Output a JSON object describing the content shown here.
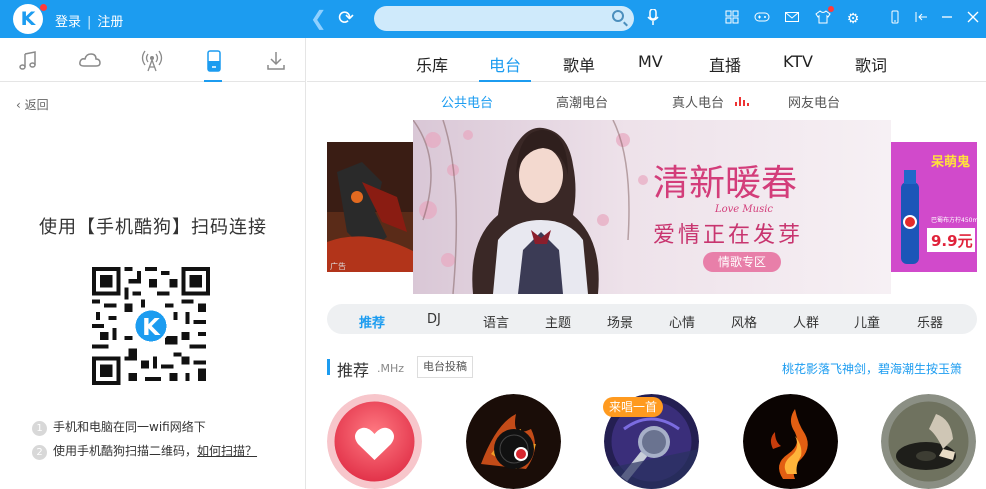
{
  "app": {
    "logo_letter": "K",
    "brand_color": "#1c9cf0",
    "login_label": "登录",
    "register_label": "注册",
    "search_placeholder": ""
  },
  "toolbar_icons": [
    "back-arrow-icon",
    "refresh-icon",
    "search-icon",
    "mic-icon",
    "grid-icon",
    "gamepad-icon",
    "mail-icon",
    "shirt-icon",
    "gear-icon",
    "phone-icon",
    "mini-mode-icon",
    "minimize-icon",
    "close-icon"
  ],
  "sidebar": {
    "tabs": [
      "music-note-icon",
      "cloud-icon",
      "radio-tower-icon",
      "mobile-phone-icon",
      "download-icon"
    ],
    "active_tab": "mobile-phone-icon",
    "back_label": "返回",
    "qr_title": "使用【手机酷狗】扫码连接",
    "steps": [
      {
        "num": "1",
        "text": "手机和电脑在同一wifi网络下"
      },
      {
        "num": "2",
        "text": "使用手机酷狗扫描二维码，",
        "link": "如何扫描？"
      }
    ]
  },
  "main": {
    "tabs": [
      "乐库",
      "电台",
      "歌单",
      "MV",
      "直播",
      "KTV",
      "歌词"
    ],
    "active_tab": "电台",
    "subtabs": [
      "公共电台",
      "高潮电台",
      "真人电台",
      "网友电台"
    ],
    "active_subtab": "公共电台",
    "banner": {
      "title": "清新暖春",
      "subtitle": "Love Music",
      "tagline": "爱情正在发芽",
      "button": "情歌专区",
      "left_ad": "广告",
      "right_ad_title": "呆萌鬼",
      "right_ad_text": "巴蜀布方柠450ml",
      "right_ad_price": "9.9元"
    },
    "categories": [
      "推荐",
      "DJ",
      "语言",
      "主题",
      "场景",
      "心情",
      "风格",
      "人群",
      "儿童",
      "乐器"
    ],
    "active_category": "推荐",
    "recommend": {
      "title": "推荐",
      "unit": ".MHz",
      "submit_button": "电台投稿",
      "link": "桃花影落飞神剑，碧海潮生按玉箫",
      "badge": "来唱一首"
    }
  }
}
